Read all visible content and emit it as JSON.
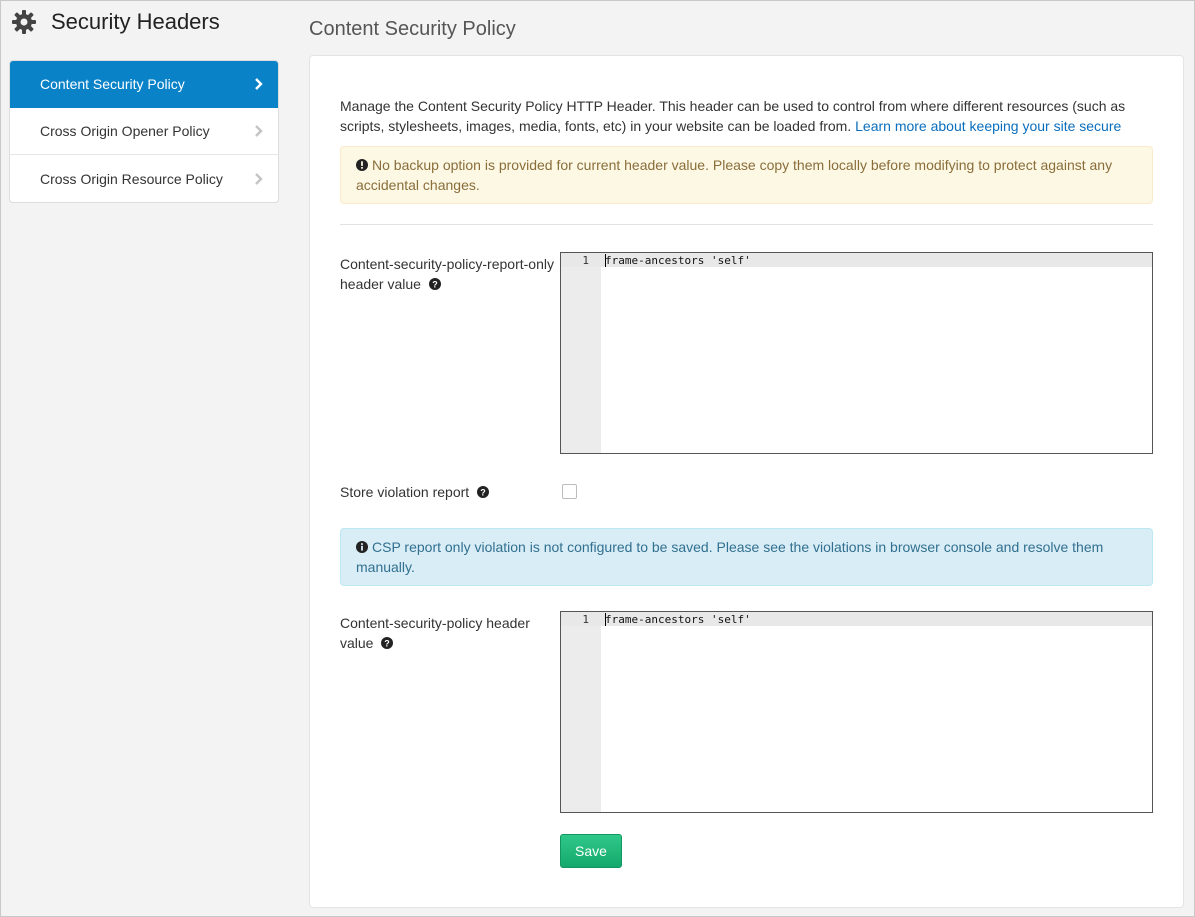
{
  "app": {
    "title": "Security Headers",
    "icon": "gear-icon"
  },
  "sidebar": {
    "items": [
      {
        "label": "Content Security Policy",
        "active": true
      },
      {
        "label": "Cross Origin Opener Policy",
        "active": false
      },
      {
        "label": "Cross Origin Resource Policy",
        "active": false
      }
    ]
  },
  "main": {
    "page_title": "Content Security Policy",
    "description": "Manage the Content Security Policy HTTP Header. This header can be used to control from where different resources (such as scripts, stylesheets, images, media, fonts, etc) in your website can be loaded from.",
    "learn_more_link": "Learn more about keeping your site secure",
    "warning_alert": "No backup option is provided for current header value. Please copy them locally before modifying to protect against any accidental changes.",
    "report_only_label": "Content-security-policy-report-only header value",
    "report_only_editor": {
      "line_number": "1",
      "value": "frame-ancestors 'self'"
    },
    "store_violation_label": "Store violation report",
    "store_violation_checked": false,
    "info_alert": "CSP report only violation is not configured to be saved. Please see the violations in browser console and resolve them manually.",
    "csp_label": "Content-security-policy header value",
    "csp_editor": {
      "line_number": "1",
      "value": "frame-ancestors 'self'"
    },
    "save_label": "Save"
  },
  "colors": {
    "active_nav": "#0a82c8",
    "link": "#0a6ebd",
    "warning_bg": "#fcf8e3",
    "info_bg": "#d9edf7",
    "save_button": "#1eb980"
  }
}
